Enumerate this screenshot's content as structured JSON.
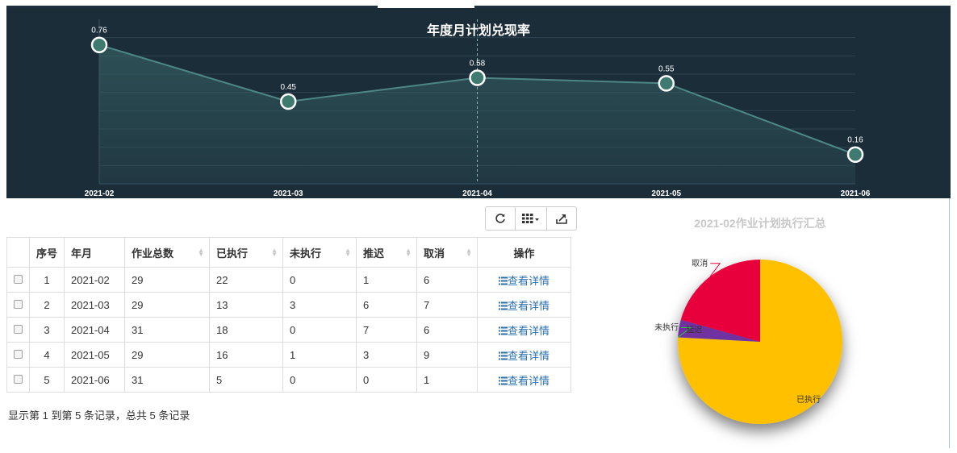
{
  "chart_data": [
    {
      "type": "area",
      "title": "年度月计划兑现率",
      "categories": [
        "2021-02",
        "2021-03",
        "2021-04",
        "2021-05",
        "2021-06"
      ],
      "values": [
        0.76,
        0.45,
        0.58,
        0.55,
        0.16
      ],
      "ylim": [
        0,
        0.9
      ],
      "grid": true,
      "colors": {
        "background": "#1c2d3a",
        "line": "#4d8785",
        "marker_fill": "#3f7a70",
        "marker_stroke": "#ffffff"
      }
    },
    {
      "type": "pie",
      "title": "2021-02作业计划执行汇总",
      "categories": [
        "已执行",
        "未执行",
        "推迟",
        "取消"
      ],
      "values": [
        22,
        0,
        1,
        6
      ],
      "labels": [
        "已执行",
        "未执行",
        "延迟",
        "取消"
      ],
      "colors": [
        "#ffc000",
        "#2ecc40",
        "#7030a0",
        "#e8003c"
      ]
    }
  ],
  "toolbar": {
    "refresh_icon": "refresh-icon",
    "columns_icon": "columns-icon",
    "export_icon": "export-icon"
  },
  "table": {
    "headers": [
      "序号",
      "年月",
      "作业总数",
      "已执行",
      "未执行",
      "推迟",
      "取消",
      "操作"
    ],
    "rows": [
      [
        "1",
        "2021-02",
        "29",
        "22",
        "0",
        "1",
        "6"
      ],
      [
        "2",
        "2021-03",
        "29",
        "13",
        "3",
        "6",
        "7"
      ],
      [
        "3",
        "2021-04",
        "31",
        "18",
        "0",
        "7",
        "6"
      ],
      [
        "4",
        "2021-05",
        "29",
        "16",
        "1",
        "3",
        "9"
      ],
      [
        "5",
        "2021-06",
        "31",
        "5",
        "0",
        "0",
        "1"
      ]
    ],
    "action_label": "查看详情"
  },
  "footer": {
    "text": "显示第 1 到第 5 条记录，总共 5 条记录"
  }
}
